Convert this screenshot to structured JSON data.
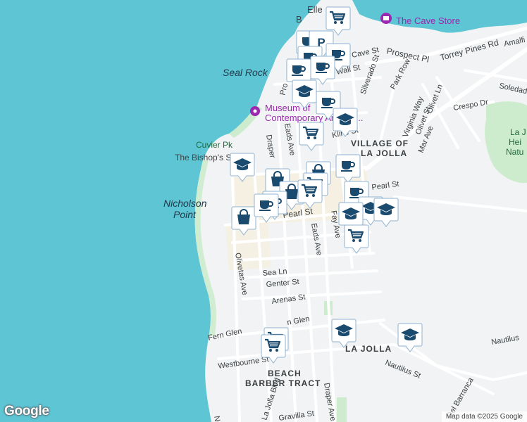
{
  "map": {
    "attribution": "Map data ©2025 Google",
    "logo_text": "Google",
    "colors": {
      "water": "#5ec5d4",
      "land": "#f1f3f4",
      "park": "#cdeccd",
      "road": "#ffffff",
      "road_outline": "#dadce0",
      "marker_fill": "#1a4a6e",
      "marker_bg": "#ffffff",
      "poi_purple": "#9c27b0"
    },
    "place_labels": {
      "seal_rock": "Seal Rock",
      "nicholson_point": "Nicholson\nPoint",
      "cuvier_pk": "Cuvier Pk",
      "bishops_school": "The Bishop's School",
      "village_of_la_jolla": "VILLAGE OF\nLA JOLLA",
      "la_jolla": "LA JOLLA",
      "beach_barber_tract": "BEACH\nBARBER TRACT",
      "museum": "Museum of\nContemporary Art San...",
      "cave_store": "The Cave Store",
      "la_jolla_heights": "La J\nHei\nNatu",
      "elle": "Elle",
      "b_partial": "B"
    },
    "streets": {
      "prospect_pl": "Prospect Pl",
      "torrey_pines_rd": "Torrey Pines Rd",
      "amalfi": "Amalfi S",
      "cave_st": "Cave St",
      "wall_st": "Wall St",
      "silverado": "Silverado St",
      "park_row": "Park Row",
      "soledad": "Soledad",
      "crespo": "Crespo Dr",
      "virginia_way": "Virginia Way",
      "olivet_st": "Olivet St",
      "olivet_ln": "Olivet Ln",
      "mar_ave": "Mar Ave",
      "kline_st": "Kline St",
      "pearl_st": "Pearl St",
      "pearl_st_east": "Pearl St",
      "eads_ave": "Eads Ave",
      "eads_ave_north": "Eads Ave",
      "fay_ave": "Fay Ave",
      "draper": "Draper",
      "draper_ave": "Draper Ave",
      "olivetas_ave": "Olivetas Ave",
      "sea_ln": "Sea Ln",
      "genter_st": "Genter St",
      "arenas_st": "Arenas St",
      "fern_glen": "Fern Glen",
      "glen": "n Glen",
      "westbourne_st": "Westbourne St",
      "nautilus_st": "Nautilus St",
      "nautilus_st_2": "Nautilus",
      "la_jolla_blvd": "La Jolla Blvd",
      "gravilla_st": "Gravilla St",
      "barranca": "Del Barranca",
      "nep": "Nep",
      "pro": "Pro"
    },
    "markers": [
      {
        "type": "cart-icon"
      },
      {
        "type": "cup-icon"
      },
      {
        "type": "parking-icon"
      },
      {
        "type": "cup-icon"
      },
      {
        "type": "cup-icon"
      },
      {
        "type": "cup-icon"
      },
      {
        "type": "cup-icon"
      },
      {
        "type": "school-icon"
      },
      {
        "type": "cup-icon"
      },
      {
        "type": "school-icon"
      },
      {
        "type": "cart-icon"
      },
      {
        "type": "school-icon"
      },
      {
        "type": "bag-icon"
      },
      {
        "type": "cup-icon"
      },
      {
        "type": "bag-icon"
      },
      {
        "type": "cart-icon"
      },
      {
        "type": "bag-icon"
      },
      {
        "type": "cup-icon"
      },
      {
        "type": "cup-icon"
      },
      {
        "type": "cart-icon"
      },
      {
        "type": "bag-icon"
      },
      {
        "type": "cup-icon"
      },
      {
        "type": "school-icon"
      },
      {
        "type": "school-icon"
      },
      {
        "type": "school-icon"
      },
      {
        "type": "cart-icon"
      },
      {
        "type": "school-icon"
      },
      {
        "type": "school-icon"
      },
      {
        "type": "cart-icon"
      },
      {
        "type": "cart-icon"
      }
    ]
  }
}
